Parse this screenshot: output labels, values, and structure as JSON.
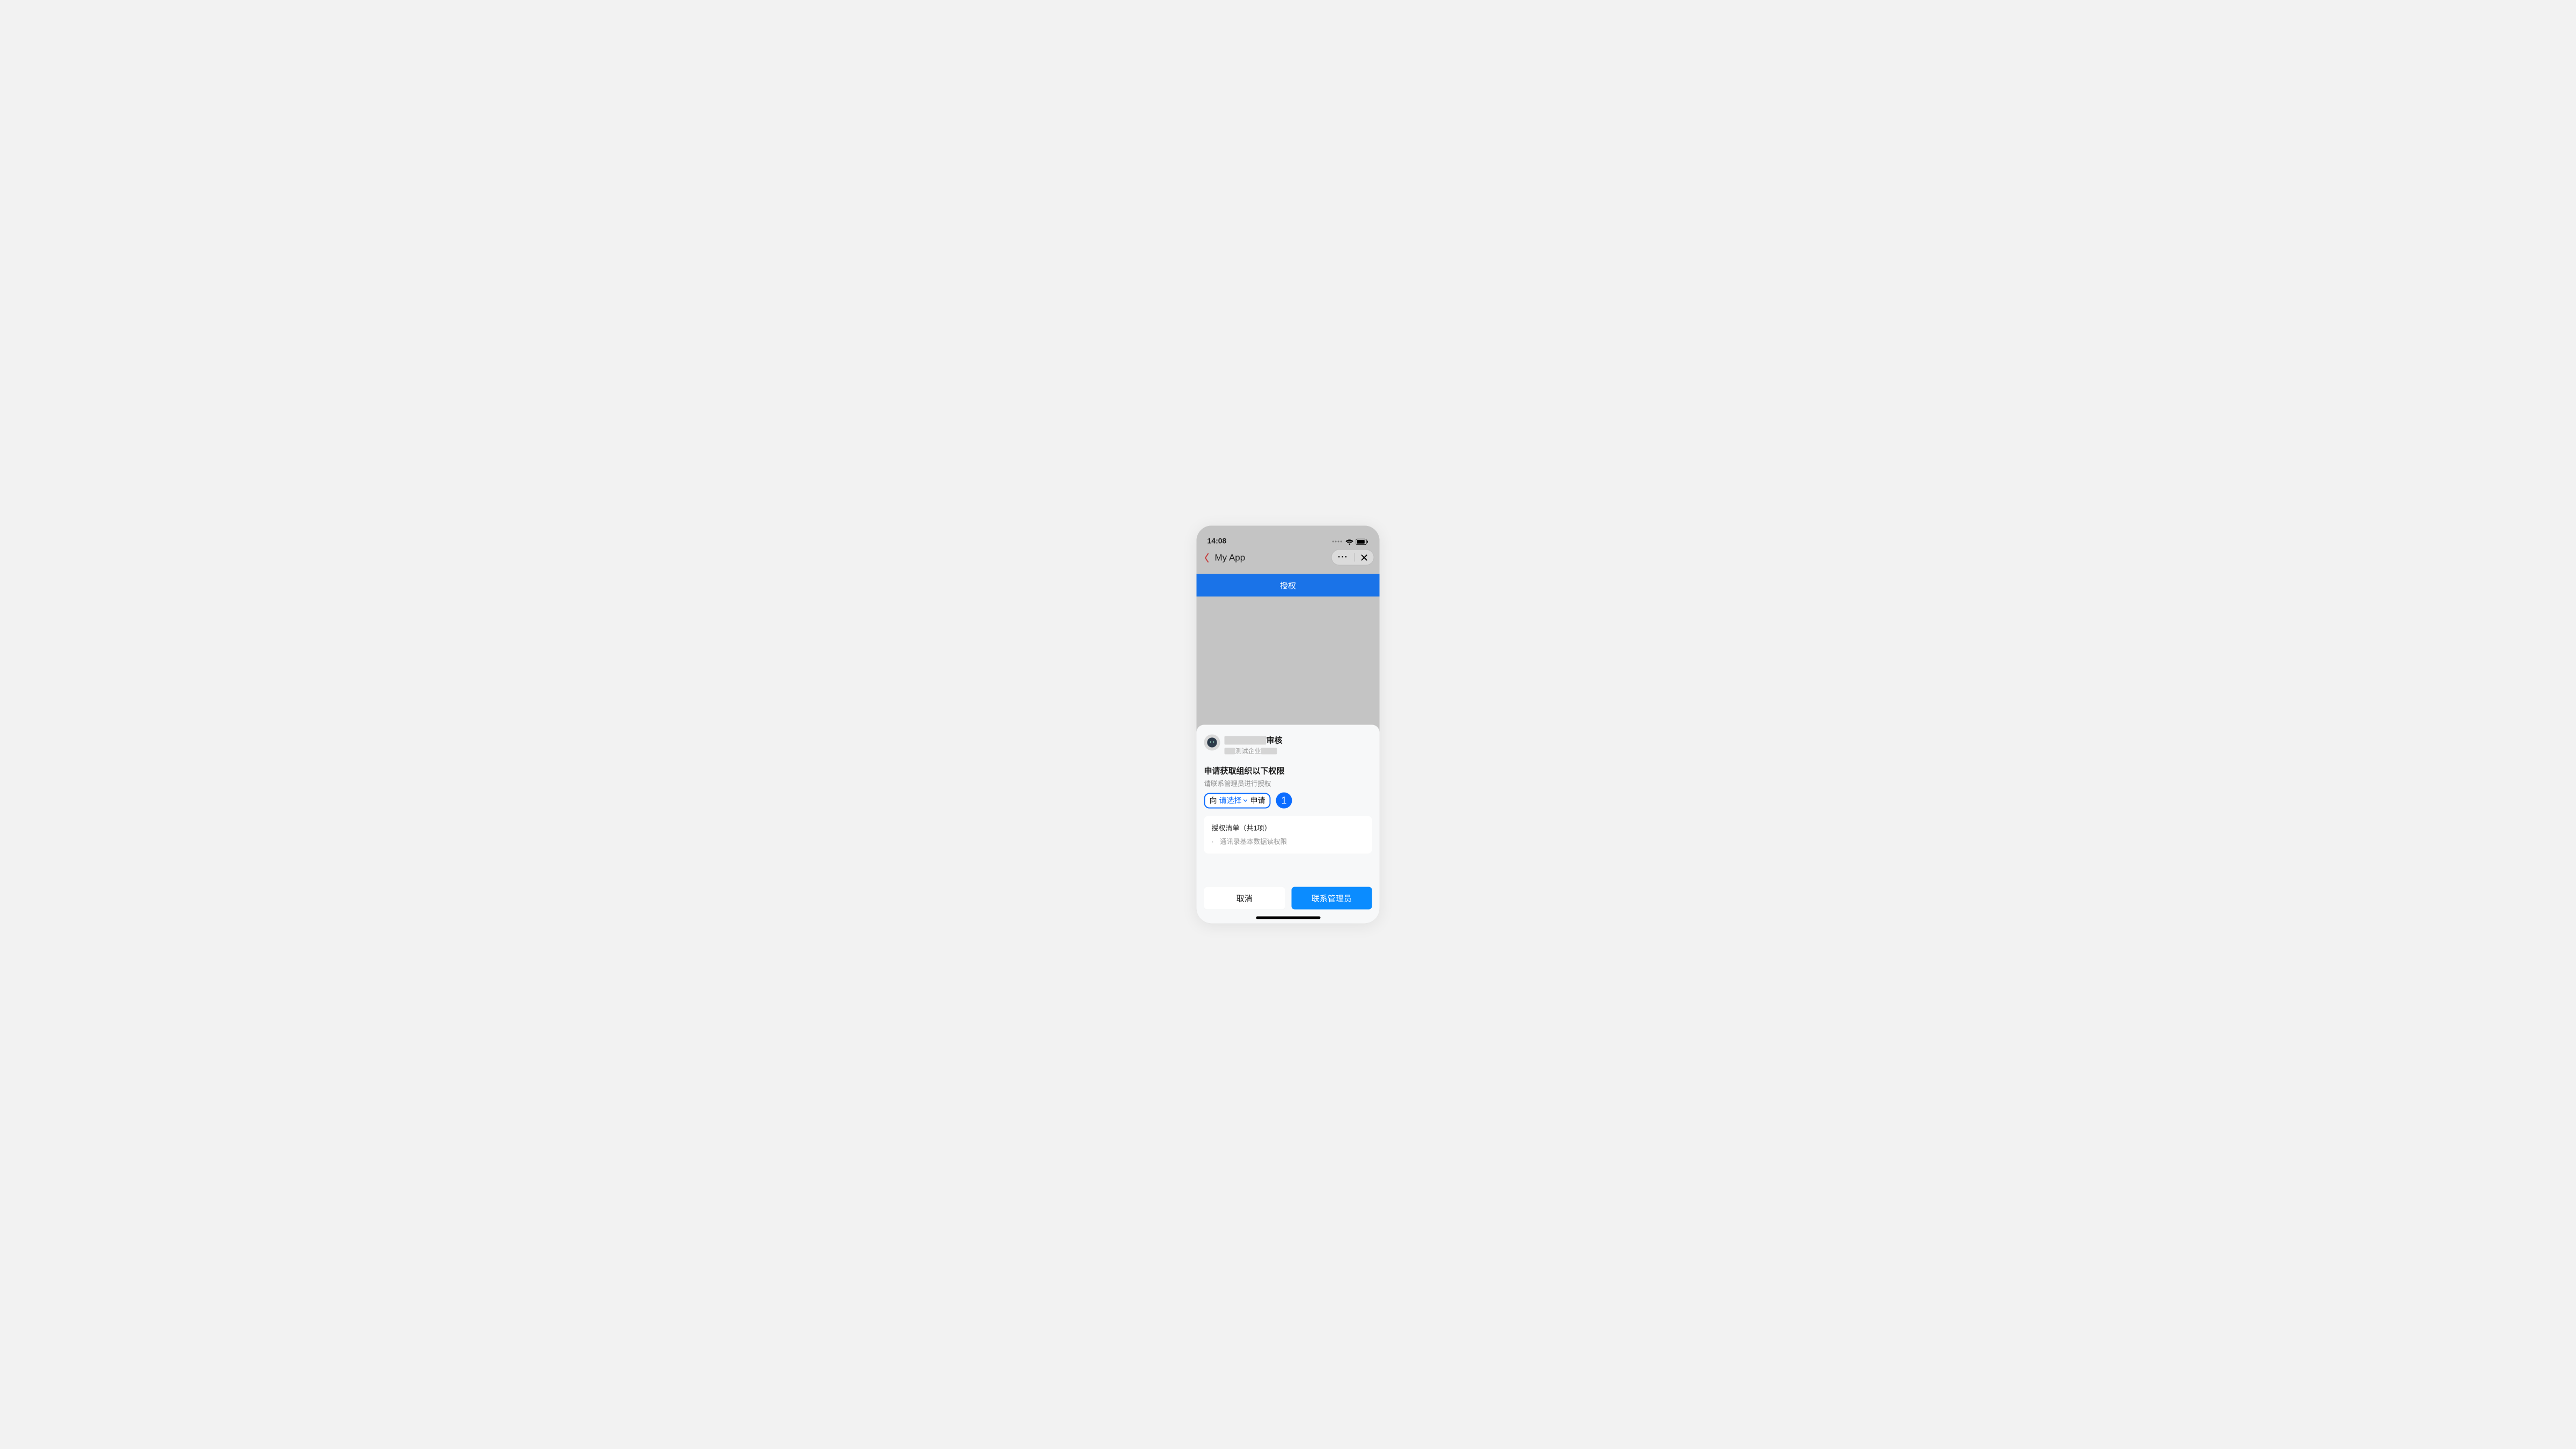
{
  "status": {
    "time": "14:08"
  },
  "nav": {
    "title": "My App"
  },
  "auth_band": {
    "label": "授权"
  },
  "sheet": {
    "app": {
      "name_suffix": "审核",
      "subtitle_visible": "测试企业"
    },
    "request": {
      "title": "申请获取组织以下权限",
      "sub": "请联系管理员进行授权"
    },
    "select": {
      "prefix": "向",
      "select_placeholder": "请选择",
      "suffix": "申请",
      "step": "1"
    },
    "perm": {
      "title": "授权清单（共1项）",
      "item1": "通讯录基本数据读权限"
    },
    "buttons": {
      "cancel": "取消",
      "contact": "联系管理员"
    }
  }
}
